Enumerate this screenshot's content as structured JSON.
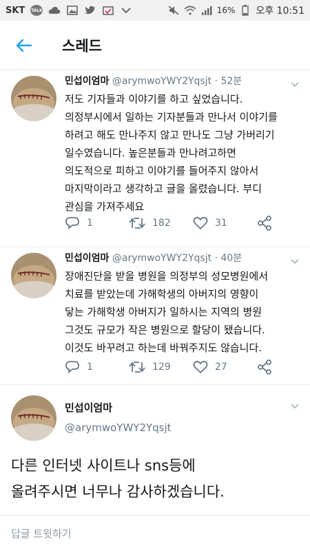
{
  "status_bar": {
    "carrier": "SKT",
    "talk_badge": "TALK",
    "battery": "16%",
    "time": "오후 10:51"
  },
  "header": {
    "title": "스레드"
  },
  "tweets": [
    {
      "name": "민섭이엄마",
      "handle": "@arymwoYWY2Yqsjt",
      "time": "· 52분",
      "text": "저도 기자들과 이야기를 하고 싶었습니다.\n의정부시에서 일하는 기자분들과 만나서 이야기를\n하려고 해도 만나주지 않고 만나도 그냥 가버리기\n일수였습니다. 높은분들과 만나려고하면\n의도적으로 피하고 이야기를 들어주지 않아서\n마지막이라고 생각하고 글을 올렸습니다. 부디\n관심을 가져주세요",
      "replies": "1",
      "retweets": "182",
      "likes": "31"
    },
    {
      "name": "민섭이엄마",
      "handle": "@arymwoYWY2Yqsjt",
      "time": "· 40분",
      "text": "장애진단을 받을 병원을 의정부의 성모병원에서\n치료를 받았는데 가해학생의 아버지의 영향이\n닿는 가해학생 아버지가 일하시는 지역의 병원\n그것도 규모가 작은 병원으로 할당이 됐습니다.\n이것도 바꾸려고 하는데 바꿔주지도 않습니다.",
      "replies": "1",
      "retweets": "129",
      "likes": "27"
    }
  ],
  "main_tweet": {
    "name": "민섭이엄마",
    "handle": "@arymwoYWY2Yqsjt",
    "text": "다른 인터넷 사이트나 sns등에\n올려주시면 너무나 감사하겠습니다."
  },
  "reply_bar": {
    "placeholder": "답글 트윗하기"
  },
  "colors": {
    "accent": "#1da1f2",
    "muted": "#657786",
    "text": "#14171a"
  }
}
